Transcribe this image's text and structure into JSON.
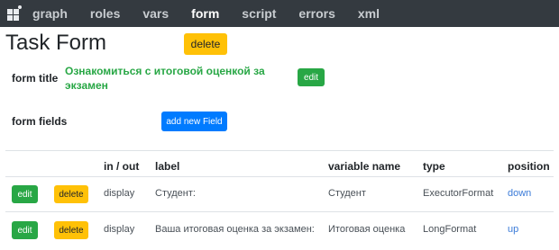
{
  "navbar": {
    "logo_icon": "app-grid-icon",
    "items": [
      {
        "label": "graph",
        "active": false
      },
      {
        "label": "roles",
        "active": false
      },
      {
        "label": "vars",
        "active": false
      },
      {
        "label": "form",
        "active": true
      },
      {
        "label": "script",
        "active": false
      },
      {
        "label": "errors",
        "active": false
      },
      {
        "label": "xml",
        "active": false
      }
    ]
  },
  "page": {
    "title": "Task Form",
    "delete_label": "delete"
  },
  "form_title": {
    "label": "form title",
    "value": "Ознакомиться с итоговой оценкой за экзамен",
    "edit_label": "edit"
  },
  "form_fields": {
    "label": "form fields",
    "add_label": "add new Field"
  },
  "table": {
    "headers": {
      "in_out": "in / out",
      "label": "label",
      "variable_name": "variable name",
      "type": "type",
      "position": "position"
    },
    "rows": [
      {
        "edit": "edit",
        "delete": "delete",
        "in_out": "display",
        "label": "Студент:",
        "variable_name": "Студент",
        "type": "ExecutorFormat",
        "position": "down"
      },
      {
        "edit": "edit",
        "delete": "delete",
        "in_out": "display",
        "label": "Ваша итоговая оценка за экзамен:",
        "variable_name": "Итоговая оценка",
        "type": "LongFormat",
        "position": "up"
      }
    ]
  },
  "colors": {
    "navbar": "#343a40",
    "success": "#28a745",
    "warning": "#ffc107",
    "primary": "#007bff",
    "link": "#3b7bd8"
  }
}
